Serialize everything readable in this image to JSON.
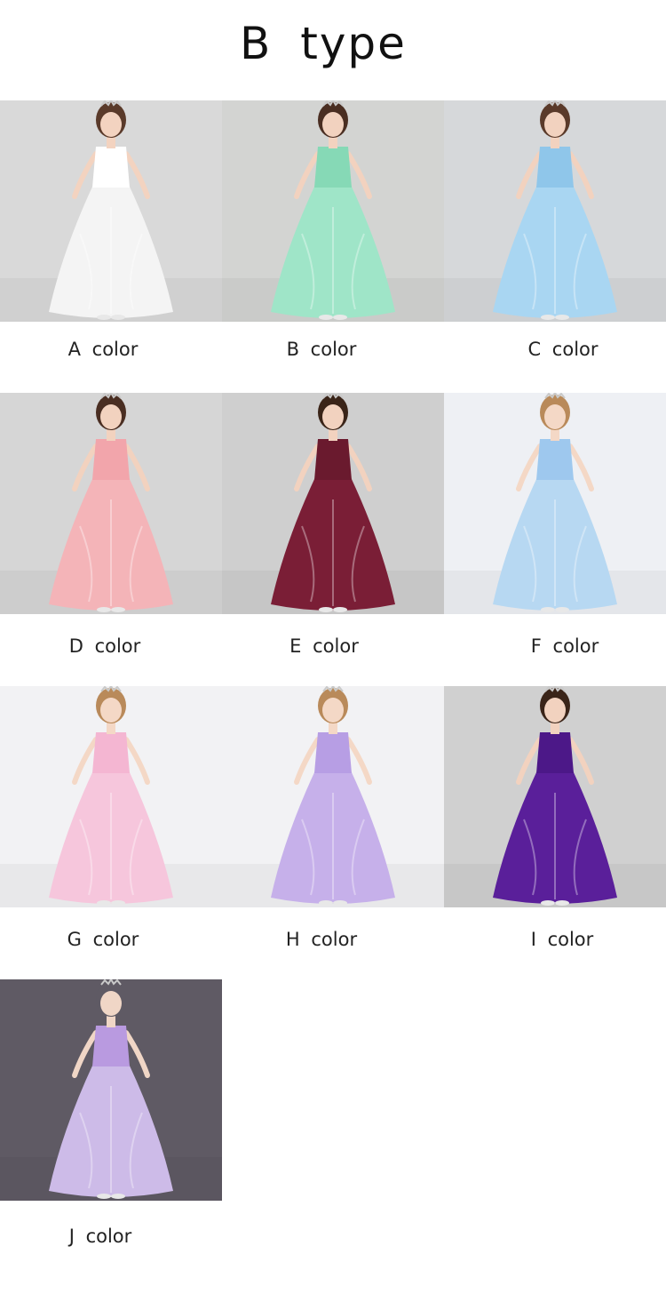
{
  "title": "B type",
  "products": [
    {
      "label": "A color",
      "bg": "#d9d9d9",
      "dress": "#f4f4f4",
      "bodice": "#ffffff",
      "hair": "#5a3a2a",
      "skin": "#f3d3c0"
    },
    {
      "label": "B color",
      "bg": "#d3d4d2",
      "dress": "#9fe5c8",
      "bodice": "#86d9b6",
      "hair": "#4a2e22",
      "skin": "#f2d2bf"
    },
    {
      "label": "C color",
      "bg": "#d6d8da",
      "dress": "#a9d6f2",
      "bodice": "#8fc6ea",
      "hair": "#5a3a2a",
      "skin": "#f2d2bf"
    },
    {
      "label": "D color",
      "bg": "#d6d6d6",
      "dress": "#f4b4b8",
      "bodice": "#f2a5ab",
      "hair": "#4a2e22",
      "skin": "#f2d2bf"
    },
    {
      "label": "E color",
      "bg": "#cfcfcf",
      "dress": "#7a1e36",
      "bodice": "#6a1a2e",
      "hair": "#3a2418",
      "skin": "#f2d2bf"
    },
    {
      "label": "F color",
      "bg": "#eef0f4",
      "dress": "#b7d8f2",
      "bodice": "#9ec8ee",
      "hair": "#b98a5a",
      "skin": "#f4d8c6"
    },
    {
      "label": "G color",
      "bg": "#f2f2f4",
      "dress": "#f6c6dc",
      "bodice": "#f4b6d2",
      "hair": "#b98a5a",
      "skin": "#f4d8c6"
    },
    {
      "label": "H color",
      "bg": "#f2f2f4",
      "dress": "#c6b0ea",
      "bodice": "#b79ee4",
      "hair": "#b98a5a",
      "skin": "#f4d8c6"
    },
    {
      "label": "I color",
      "bg": "#d0d0d0",
      "dress": "#5a1f9a",
      "bodice": "#4c1888",
      "hair": "#3a2418",
      "skin": "#f2d2bf"
    },
    {
      "label": "J color",
      "bg": "#5f5a64",
      "dress": "#cdbbe8",
      "bodice": "#b99ae0",
      "hair": "#5f5a64",
      "skin": "#f0d6c6"
    }
  ]
}
